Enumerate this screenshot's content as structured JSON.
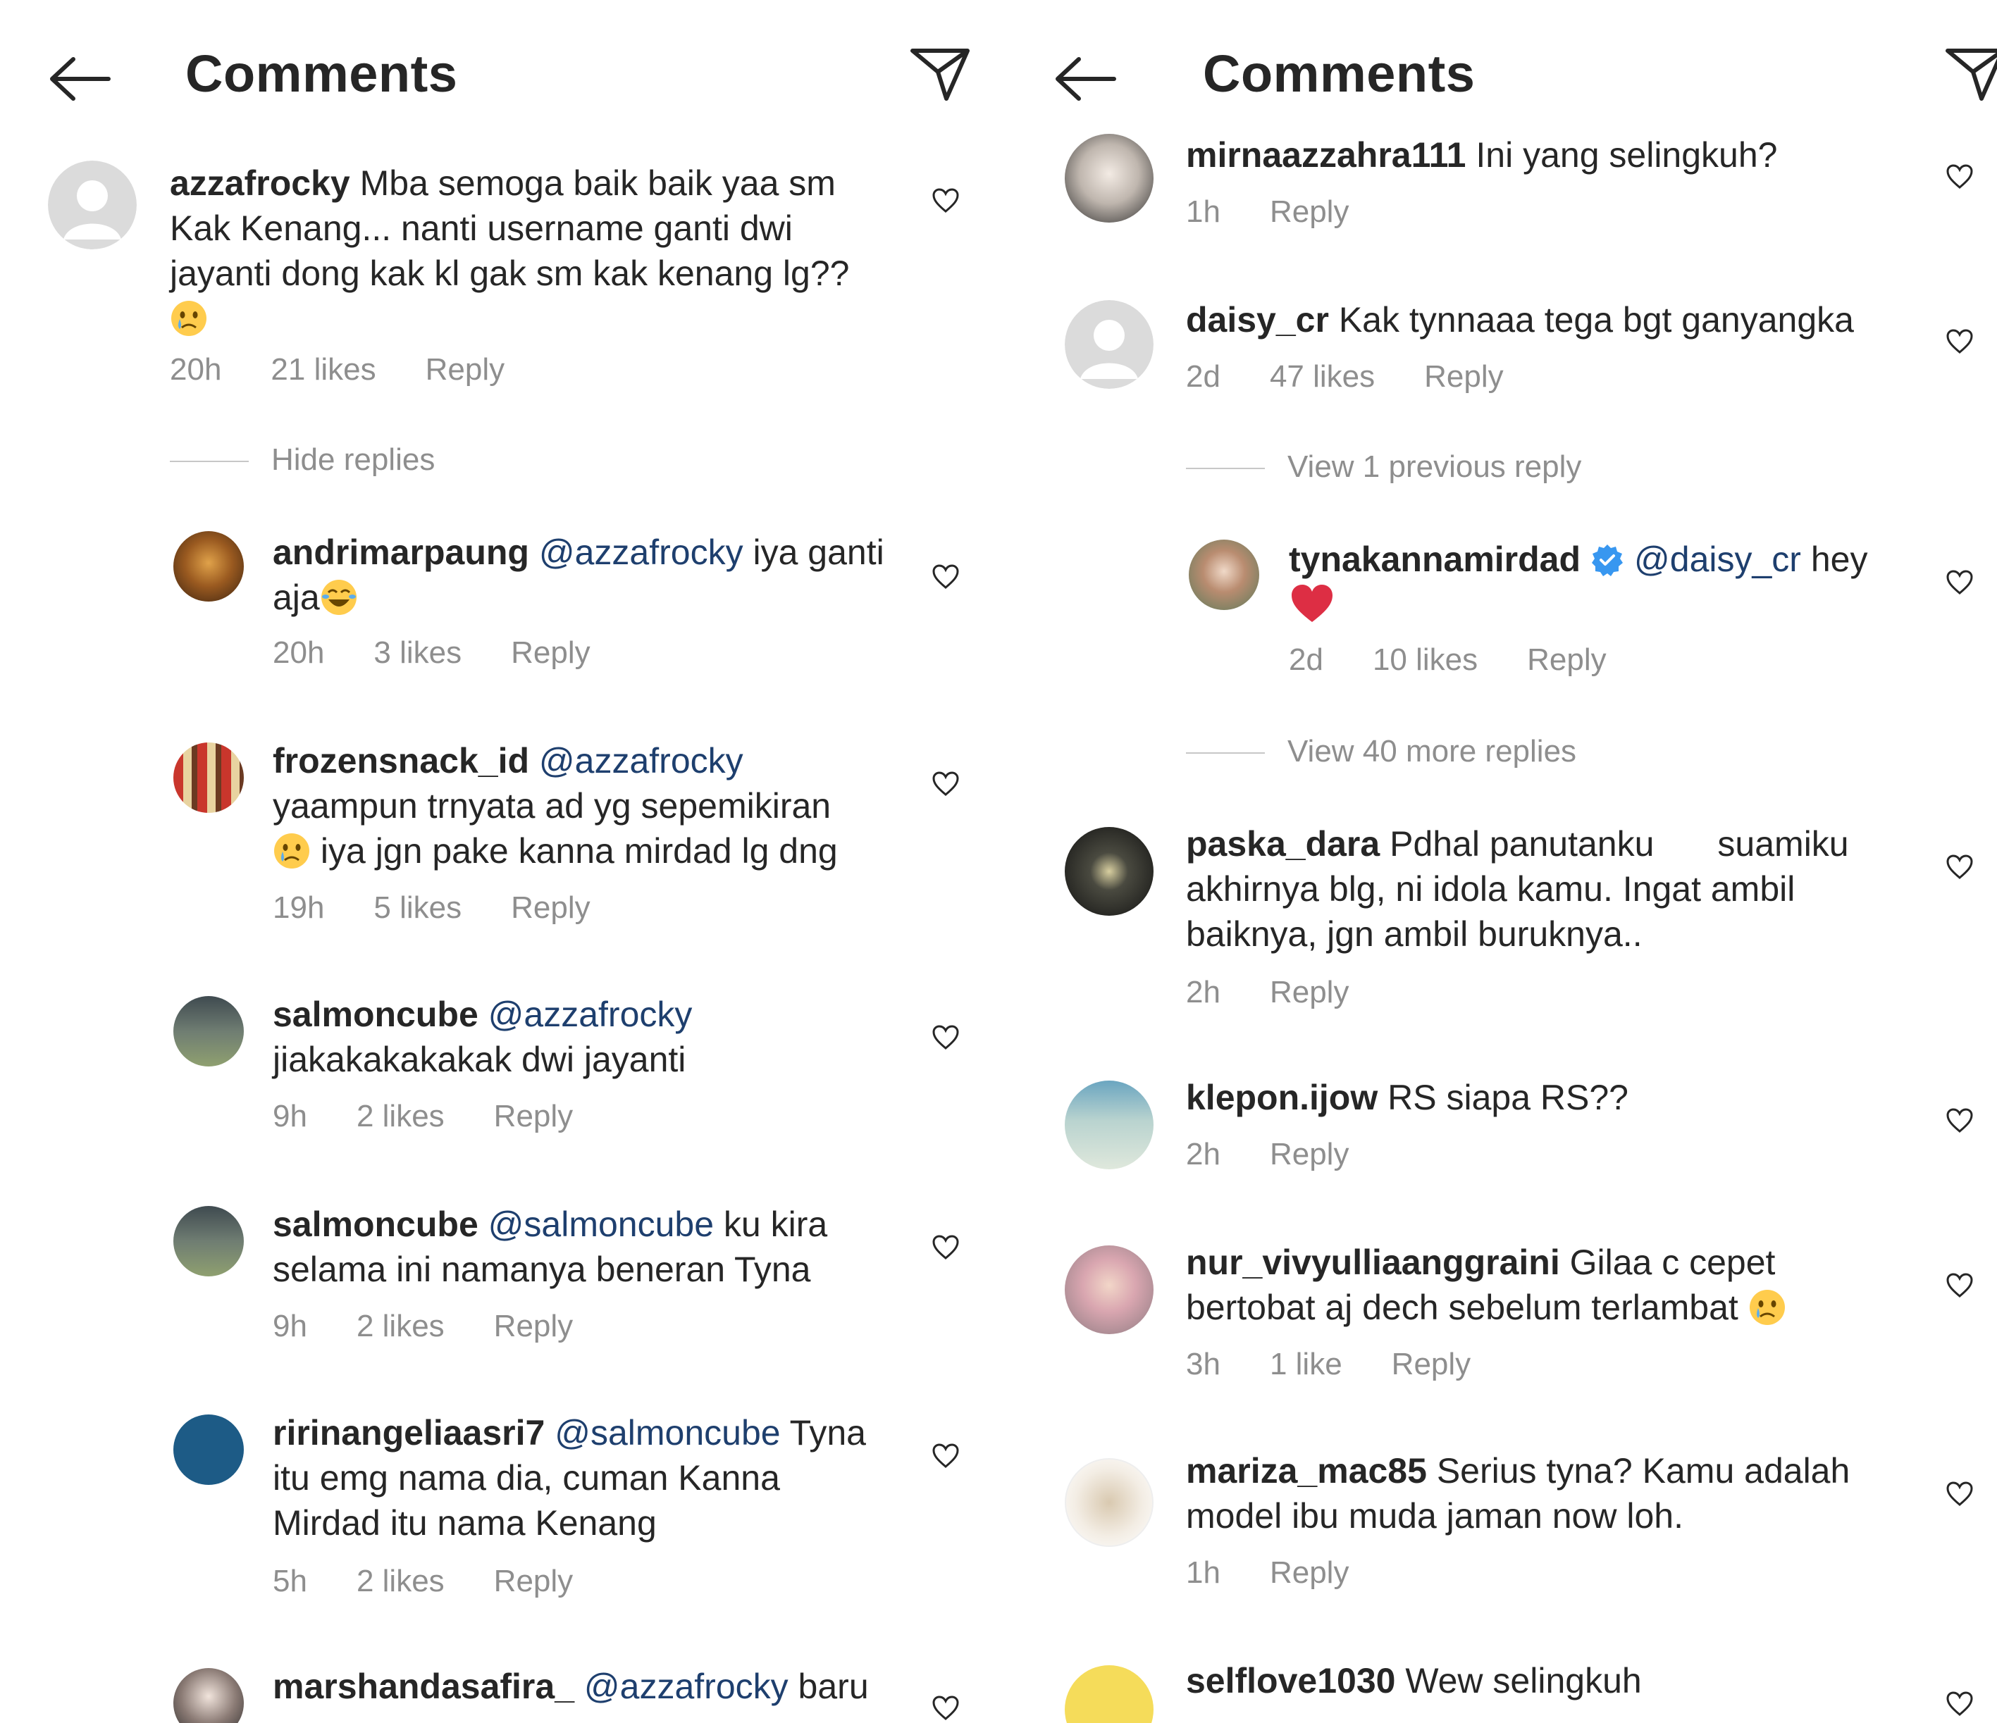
{
  "left": {
    "title": "Comments",
    "top_comment": {
      "username": "azzafrocky",
      "text": "Mba semoga baik baik yaa sm Kak Kenang... nanti username ganti dwi jayanti dong kak kl gak sm kak kenang lg??",
      "time": "20h",
      "likes": "21 likes",
      "reply": "Reply"
    },
    "hide_replies": "Hide replies",
    "replies": [
      {
        "username": "andrimarpaung",
        "mention": "@azzafrocky",
        "text_a": " iya ganti",
        "text_b": "aja",
        "time": "20h",
        "likes": "3 likes",
        "reply": "Reply"
      },
      {
        "username": "frozensnack_id",
        "mention": "@azzafrocky",
        "text_a": "yaampun trnyata ad yg sepemikiran",
        "text_b": " iya jgn pake kanna mirdad lg dng",
        "time": "19h",
        "likes": "5 likes",
        "reply": "Reply"
      },
      {
        "username": "salmoncube",
        "mention": "@azzafrocky",
        "text_a": "jiakakakakakak dwi jayanti",
        "time": "9h",
        "likes": "2 likes",
        "reply": "Reply"
      },
      {
        "username": "salmoncube",
        "mention": "@salmoncube",
        "text_a": " ku kira",
        "text_b": "selama ini namanya beneran Tyna",
        "time": "9h",
        "likes": "2 likes",
        "reply": "Reply"
      },
      {
        "username": "ririnangeliaasri7",
        "mention": "@salmoncube",
        "text_a": " Tyna",
        "text_b": "itu emg nama dia, cuman Kanna",
        "text_c": "Mirdad itu nama Kenang",
        "time": "5h",
        "likes": "2 likes",
        "reply": "Reply"
      },
      {
        "username": "marshandasafira_",
        "mention": "@azzafrocky",
        "text_a": " baru"
      }
    ]
  },
  "right": {
    "title": "Comments",
    "comments": [
      {
        "username": "mirnaazzahra111",
        "text": " Ini yang selingkuh?",
        "time": "1h",
        "reply": "Reply"
      },
      {
        "username": "daisy_cr",
        "text": " Kak tynnaaa tega bgt ganyangka",
        "time": "2d",
        "likes": "47 likes",
        "reply": "Reply"
      },
      {
        "username": "paska_dara",
        "text_a": " Pdhal panutanku",
        "text_a2": "suamiku",
        "text_b": "akhirnya blg, ni idola kamu. Ingat ambil",
        "text_c": "baiknya, jgn ambil buruknya..",
        "time": "2h",
        "reply": "Reply"
      },
      {
        "username": "klepon.ijow",
        "text": " RS siapa RS??",
        "time": "2h",
        "reply": "Reply"
      },
      {
        "username": "nur_vivyulliaanggraini",
        "text_a": " Gilaa c cepet",
        "text_b": "bertobat aj dech sebelum terlambat ",
        "time": "3h",
        "likes": "1 like",
        "reply": "Reply"
      },
      {
        "username": "mariza_mac85",
        "text_a": " Serius tyna? Kamu adalah",
        "text_b": "model ibu muda jaman now loh.",
        "time": "1h",
        "reply": "Reply"
      },
      {
        "username": "selflove1030",
        "text": " Wew selingkuh"
      }
    ],
    "view_previous": "View 1 previous reply",
    "view_more": "View 40 more replies",
    "nested_reply": {
      "username": "tynakannamirdad",
      "mention": "@daisy_cr",
      "text": " hey",
      "time": "2d",
      "likes": "10 likes",
      "reply": "Reply"
    }
  },
  "colors": {
    "text": "#262626",
    "meta": "#8e8e8e",
    "mention": "#1e3f6e",
    "verified": "#3897f0",
    "heart_red": "#e0245e"
  },
  "icons": [
    "back-arrow-icon",
    "send-icon",
    "heart-outline-icon",
    "verified-badge-icon",
    "crying-emoji-icon",
    "laughing-emoji-icon",
    "red-heart-emoji-icon"
  ]
}
